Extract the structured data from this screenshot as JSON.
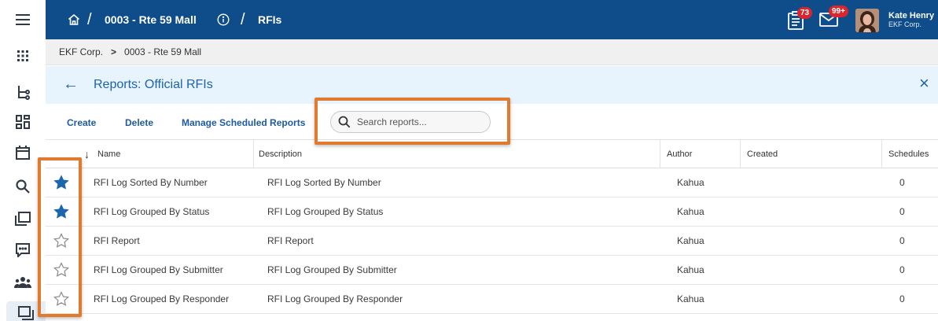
{
  "topbar": {
    "project": "0003 - Rte 59 Mall",
    "module": "RFIs",
    "sep": "/",
    "tasks_count": "73",
    "messages_count": "99+",
    "user_name": "Kate Henry",
    "user_org": "EKF Corp."
  },
  "breadcrumb": {
    "org": "EKF Corp.",
    "chevron": ">",
    "project": "0003 - Rte 59 Mall"
  },
  "reports": {
    "title": "Reports: Official RFIs",
    "close": "×",
    "back": "←"
  },
  "toolbar": {
    "create": "Create",
    "delete": "Delete",
    "manage": "Manage Scheduled Reports",
    "search_placeholder": "Search reports..."
  },
  "table": {
    "sort_arrow": "↓",
    "columns": {
      "name": "Name",
      "description": "Description",
      "author": "Author",
      "created": "Created",
      "schedules": "Schedules"
    },
    "rows": [
      {
        "favorite": true,
        "name": "RFI Log Sorted By Number",
        "description": "RFI Log Sorted By Number",
        "author": "Kahua",
        "created": "",
        "schedules": "0"
      },
      {
        "favorite": true,
        "name": "RFI Log Grouped By Status",
        "description": "RFI Log Grouped By Status",
        "author": "Kahua",
        "created": "",
        "schedules": "0"
      },
      {
        "favorite": false,
        "name": "RFI Report",
        "description": "RFI Report",
        "author": "Kahua",
        "created": "",
        "schedules": "0"
      },
      {
        "favorite": false,
        "name": "RFI Log Grouped By Submitter",
        "description": "RFI Log Grouped By Submitter",
        "author": "Kahua",
        "created": "",
        "schedules": "0"
      },
      {
        "favorite": false,
        "name": "RFI Log Grouped By Responder",
        "description": "RFI Log Grouped By Responder",
        "author": "Kahua",
        "created": "",
        "schedules": "0"
      }
    ]
  },
  "colors": {
    "topbar": "#0e4d8a",
    "accent": "#1d63a8",
    "star_filled": "#1b67ad",
    "highlight": "#e07a2e"
  },
  "icons": {
    "rail": [
      "menu-icon",
      "apps-grid-icon",
      "hierarchy-icon",
      "dashboard-icon",
      "calendar-icon",
      "search-icon",
      "documents-icon",
      "chat-icon",
      "people-icon",
      "reports-icon"
    ],
    "topbar": [
      "home-icon",
      "info-icon",
      "tasks-icon",
      "mail-icon"
    ]
  }
}
